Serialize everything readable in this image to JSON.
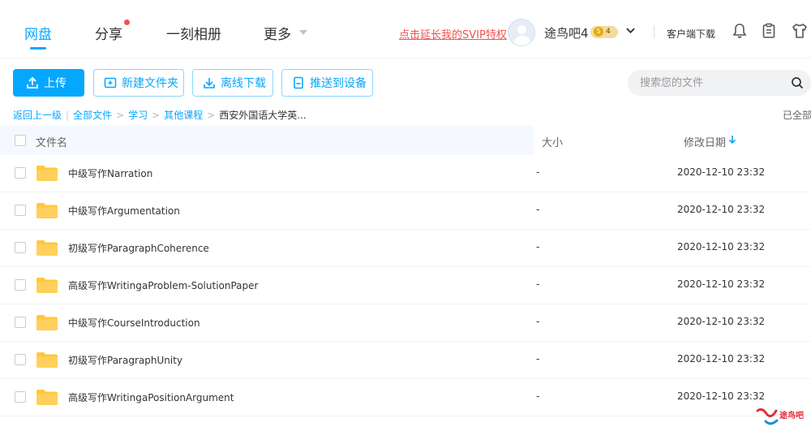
{
  "nav": {
    "items": [
      {
        "label": "网盘",
        "active": true
      },
      {
        "label": "分享",
        "badge": true
      },
      {
        "label": "一刻相册"
      },
      {
        "label": "更多"
      }
    ]
  },
  "header": {
    "svip_link": "点击延长我的SVIP特权",
    "username": "途鸟吧4",
    "vip_level": "4",
    "vip_coin": "S",
    "client_download": "客户端下载"
  },
  "toolbar": {
    "upload": "上传",
    "new_folder": "新建文件夹",
    "offline_download": "离线下载",
    "push_device": "推送到设备",
    "search_placeholder": "搜索您的文件"
  },
  "breadcrumb": {
    "back": "返回上一级",
    "items": [
      "全部文件",
      "学习",
      "其他课程"
    ],
    "current": "西安外国语大学英...",
    "loaded": "已全部"
  },
  "table": {
    "headers": {
      "name": "文件名",
      "size": "大小",
      "date": "修改日期"
    },
    "rows": [
      {
        "name": "中级写作Narration",
        "size": "-",
        "date": "2020-12-10 23:32"
      },
      {
        "name": "中级写作Argumentation",
        "size": "-",
        "date": "2020-12-10 23:32"
      },
      {
        "name": "初级写作ParagraphCoherence",
        "size": "-",
        "date": "2020-12-10 23:32"
      },
      {
        "name": "高级写作WritingaProblem-SolutionPaper",
        "size": "-",
        "date": "2020-12-10 23:32"
      },
      {
        "name": "中级写作CourseIntroduction",
        "size": "-",
        "date": "2020-12-10 23:32"
      },
      {
        "name": "初级写作ParagraphUnity",
        "size": "-",
        "date": "2020-12-10 23:32"
      },
      {
        "name": "高级写作WritingaPositionArgument",
        "size": "-",
        "date": "2020-12-10 23:32"
      }
    ]
  },
  "watermark": {
    "text": "途鸟吧"
  },
  "colors": {
    "accent": "#06a7ff",
    "alert": "#f25151",
    "folder": "#ffc73d"
  }
}
